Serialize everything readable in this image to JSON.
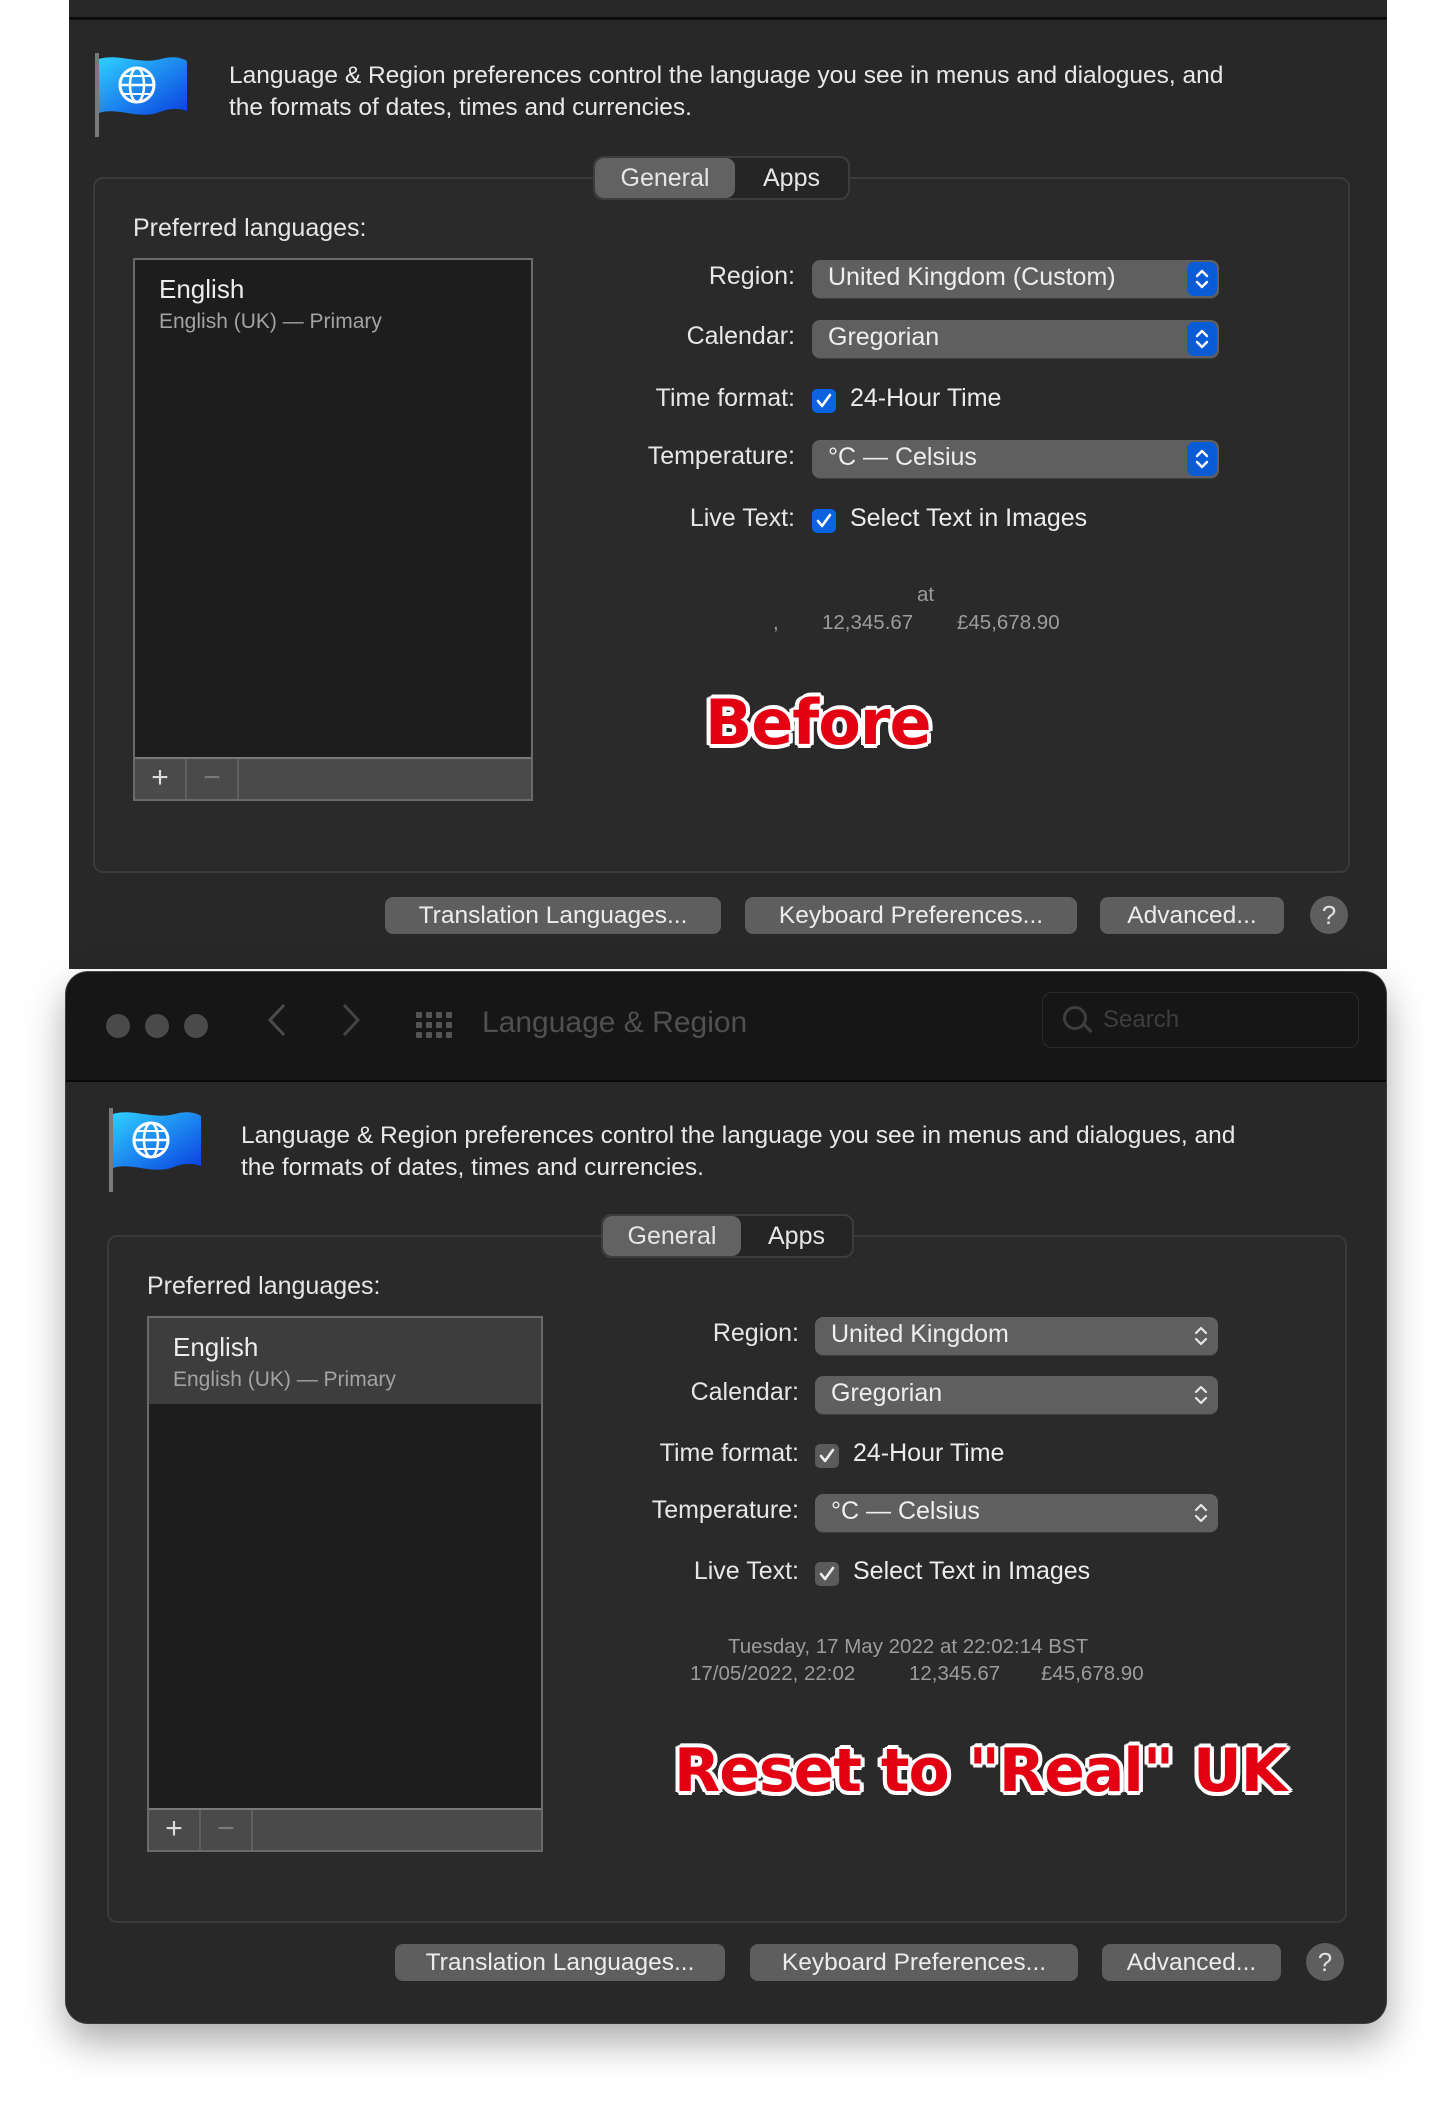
{
  "colors": {
    "window_bg": "#282828",
    "accent_blue": "#0a63e0",
    "annotation_red": "#e30012"
  },
  "before": {
    "intro_line1": "Language & Region preferences control the language you see in menus and dialogues, and",
    "intro_line2": "the formats of dates, times and currencies.",
    "tabs": [
      {
        "label": "General",
        "active": true
      },
      {
        "label": "Apps",
        "active": false
      }
    ],
    "preferred_languages_label": "Preferred languages:",
    "languages": [
      {
        "title": "English",
        "subtitle": "English (UK) — Primary"
      }
    ],
    "add_label": "+",
    "remove_label": "−",
    "region": {
      "label": "Region:",
      "value": "United Kingdom (Custom)"
    },
    "calendar": {
      "label": "Calendar:",
      "value": "Gregorian"
    },
    "time_format": {
      "label": "Time format:",
      "option": "24-Hour Time",
      "checked": true
    },
    "temperature": {
      "label": "Temperature:",
      "value": "°C — Celsius"
    },
    "live_text": {
      "label": "Live Text:",
      "option": "Select Text in Images",
      "checked": true
    },
    "preview": {
      "line1": "at",
      "date_short": ",",
      "number": "12,345.67",
      "currency": "£45,678.90"
    },
    "annotation": "Before",
    "buttons": {
      "translation": "Translation Languages...",
      "keyboard": "Keyboard Preferences...",
      "advanced": "Advanced...",
      "help": "?"
    }
  },
  "after": {
    "window_title": "Language & Region",
    "back_icon": "chevron-left-icon",
    "forward_icon": "chevron-right-icon",
    "search_placeholder": "Search",
    "intro_line1": "Language & Region preferences control the language you see in menus and dialogues, and",
    "intro_line2": "the formats of dates, times and currencies.",
    "tabs": [
      {
        "label": "General",
        "active": true
      },
      {
        "label": "Apps",
        "active": false
      }
    ],
    "preferred_languages_label": "Preferred languages:",
    "languages": [
      {
        "title": "English",
        "subtitle": "English (UK) — Primary",
        "selected": true
      }
    ],
    "add_label": "+",
    "remove_label": "−",
    "region": {
      "label": "Region:",
      "value": "United Kingdom"
    },
    "calendar": {
      "label": "Calendar:",
      "value": "Gregorian"
    },
    "time_format": {
      "label": "Time format:",
      "option": "24-Hour Time",
      "checked": true
    },
    "temperature": {
      "label": "Temperature:",
      "value": "°C — Celsius"
    },
    "live_text": {
      "label": "Live Text:",
      "option": "Select Text in Images",
      "checked": true
    },
    "preview": {
      "line1": "Tuesday, 17 May 2022 at 22:02:14 BST",
      "date_short": "17/05/2022, 22:02",
      "number": "12,345.67",
      "currency": "£45,678.90"
    },
    "annotation": "Reset to \"Real\" UK",
    "buttons": {
      "translation": "Translation Languages...",
      "keyboard": "Keyboard Preferences...",
      "advanced": "Advanced...",
      "help": "?"
    }
  }
}
